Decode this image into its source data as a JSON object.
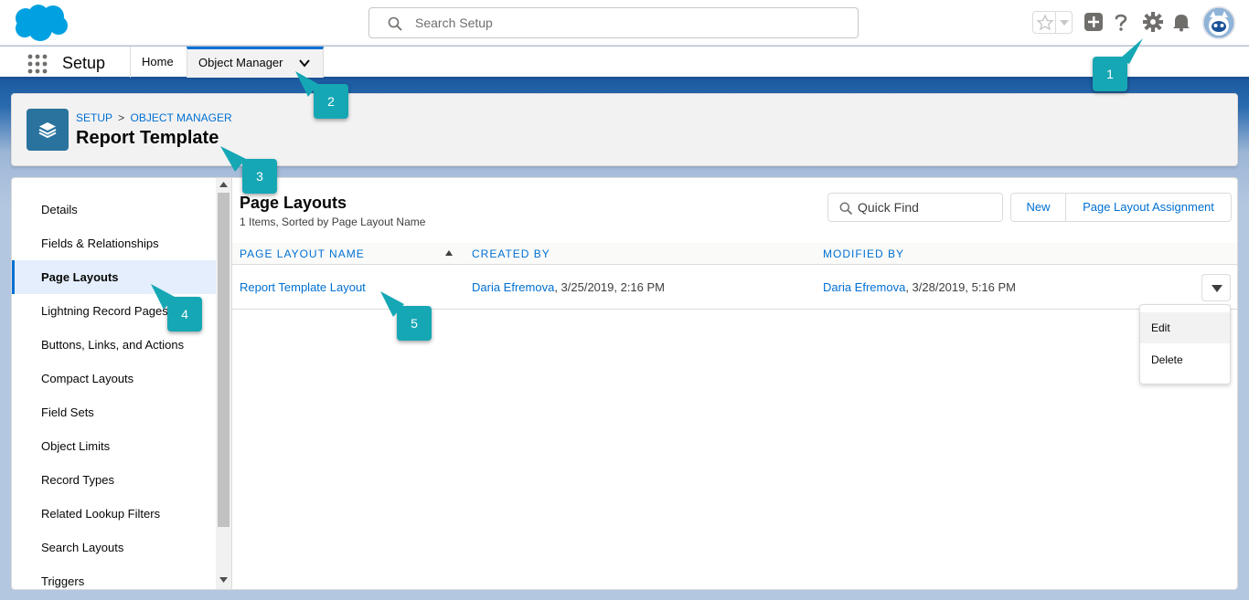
{
  "header": {
    "search_placeholder": "Search Setup"
  },
  "context_bar": {
    "app_name": "Setup",
    "tabs": [
      {
        "label": "Home"
      },
      {
        "label": "Object Manager"
      }
    ]
  },
  "object_header": {
    "breadcrumb": [
      "SETUP",
      "OBJECT MANAGER"
    ],
    "breadcrumb_separator": ">",
    "title": "Report Template"
  },
  "sidebar": {
    "items": [
      {
        "label": "Details"
      },
      {
        "label": "Fields & Relationships"
      },
      {
        "label": "Page Layouts"
      },
      {
        "label": "Lightning Record Pages"
      },
      {
        "label": "Buttons, Links, and Actions"
      },
      {
        "label": "Compact Layouts"
      },
      {
        "label": "Field Sets"
      },
      {
        "label": "Object Limits"
      },
      {
        "label": "Record Types"
      },
      {
        "label": "Related Lookup Filters"
      },
      {
        "label": "Search Layouts"
      },
      {
        "label": "Triggers"
      }
    ],
    "active_index": 2
  },
  "content": {
    "title": "Page Layouts",
    "subtitle": "1 Items, Sorted by Page Layout Name",
    "quick_find_placeholder": "Quick Find",
    "new_button": "New",
    "assignment_button": "Page Layout Assignment",
    "columns": [
      "PAGE LAYOUT NAME",
      "CREATED BY",
      "MODIFIED BY"
    ],
    "rows": [
      {
        "name": "Report Template Layout",
        "created_by": "Daria Efremova",
        "created_at": ", 3/25/2019, 2:16 PM",
        "modified_by": "Daria Efremova",
        "modified_at": ", 3/28/2019, 5:16 PM"
      }
    ],
    "row_menu": [
      "Edit",
      "Delete"
    ]
  },
  "callouts": [
    "1",
    "2",
    "3",
    "4",
    "5"
  ],
  "colors": {
    "brand": "#00a1e0",
    "link": "#0070d2",
    "callout": "#16a7b5",
    "object_icon": "#2a739e"
  }
}
